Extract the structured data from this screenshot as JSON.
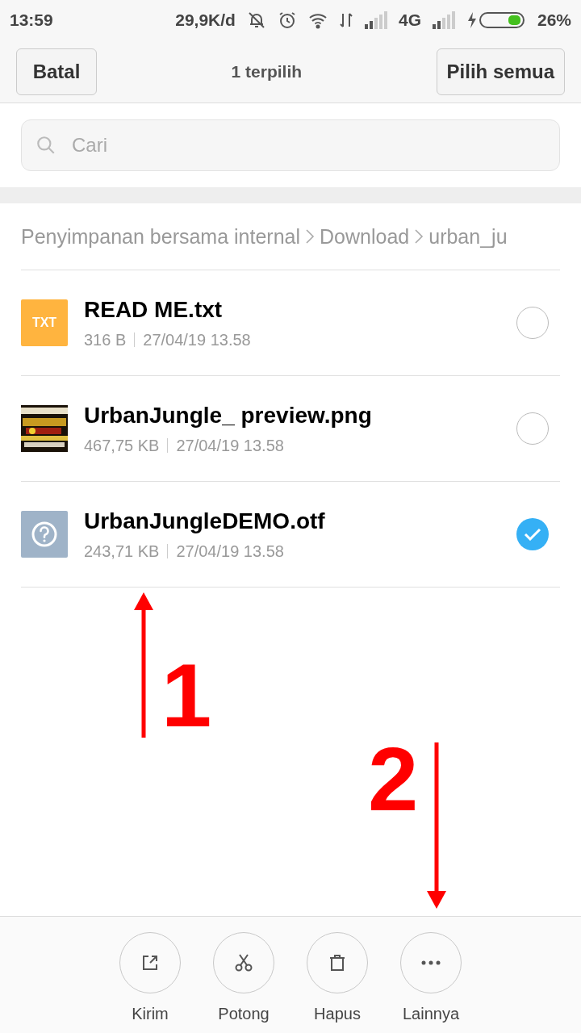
{
  "status_bar": {
    "time": "13:59",
    "speed": "29,9K/d",
    "network": "4G",
    "battery": "26%"
  },
  "top_bar": {
    "cancel": "Batal",
    "title": "1 terpilih",
    "select_all": "Pilih semua"
  },
  "search": {
    "placeholder": "Cari"
  },
  "breadcrumb": [
    "Penyimpanan bersama internal",
    "Download",
    "urban_ju"
  ],
  "files": [
    {
      "kind": "txt",
      "icon_label": "TXT",
      "name": "READ ME.txt",
      "size": "316 B",
      "date": "27/04/19 13.58",
      "selected": false
    },
    {
      "name": "UrbanJungle_ preview.png",
      "size": "467,75 KB",
      "date": "27/04/19 13.58",
      "selected": false
    },
    {
      "kind": "unknown",
      "name": "UrbanJungleDEMO.otf",
      "size": "243,71 KB",
      "date": "27/04/19 13.58",
      "selected": true
    }
  ],
  "annotations": [
    {
      "kind": "up",
      "label": "1"
    },
    {
      "kind": "down",
      "label": "2"
    }
  ],
  "actions": [
    {
      "kind": "send",
      "label": "Kirim"
    },
    {
      "kind": "cut",
      "label": "Potong"
    },
    {
      "kind": "delete",
      "label": "Hapus"
    },
    {
      "kind": "more",
      "label": "Lainnya"
    }
  ]
}
